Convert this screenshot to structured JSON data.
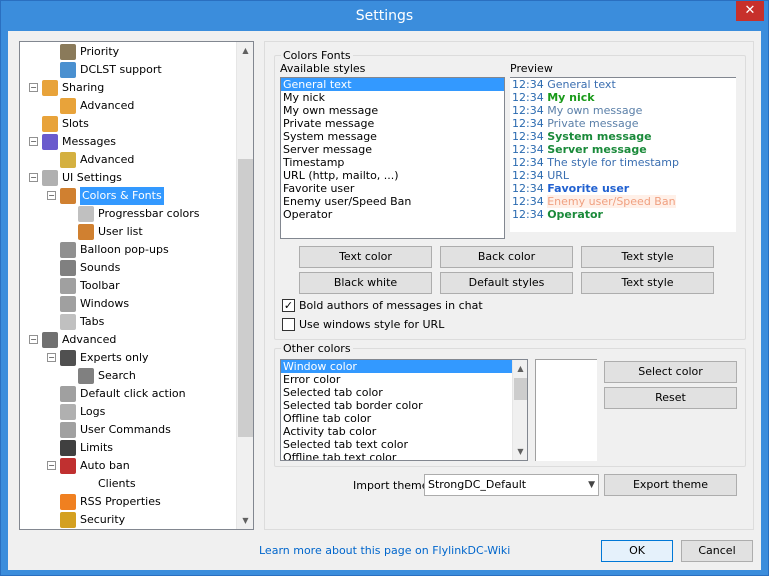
{
  "window": {
    "title": "Settings",
    "close_glyph": "✕"
  },
  "tree": {
    "items": [
      {
        "label": "Priority",
        "icon": "priority-icon",
        "color": "#8a7a5a"
      },
      {
        "label": "DCLST support",
        "icon": "dclst-icon",
        "color": "#4a90d0"
      },
      {
        "label": "Sharing",
        "icon": "sharing-icon",
        "color": "#e8a33a"
      },
      {
        "label": "Advanced",
        "icon": "advanced-sharing-icon",
        "color": "#e8a33a"
      },
      {
        "label": "Slots",
        "icon": "slots-icon",
        "color": "#e8a33a"
      },
      {
        "label": "Messages",
        "icon": "messages-icon",
        "color": "#6a5acd"
      },
      {
        "label": "Advanced",
        "icon": "advanced-messages-icon",
        "color": "#d4b040"
      },
      {
        "label": "UI Settings",
        "icon": "ui-settings-icon",
        "color": "#b0b0b0"
      },
      {
        "label": "Colors & Fonts",
        "icon": "palette-icon",
        "color": "#d08030"
      },
      {
        "label": "Progressbar colors",
        "icon": "progressbar-icon",
        "color": "#c0c0c0"
      },
      {
        "label": "User list",
        "icon": "user-list-icon",
        "color": "#d08030"
      },
      {
        "label": "Balloon pop-ups",
        "icon": "balloon-icon",
        "color": "#909090"
      },
      {
        "label": "Sounds",
        "icon": "speaker-icon",
        "color": "#808080"
      },
      {
        "label": "Toolbar",
        "icon": "toolbar-icon",
        "color": "#a0a0a0"
      },
      {
        "label": "Windows",
        "icon": "windows-icon",
        "color": "#a0a0a0"
      },
      {
        "label": "Tabs",
        "icon": "tabs-icon",
        "color": "#c0c0c0"
      },
      {
        "label": "Advanced",
        "icon": "tools-icon",
        "color": "#707070"
      },
      {
        "label": "Experts only",
        "icon": "expert-icon",
        "color": "#505050"
      },
      {
        "label": "Search",
        "icon": "search-icon",
        "color": "#808080"
      },
      {
        "label": "Default click action",
        "icon": "mouse-icon",
        "color": "#a0a0a0"
      },
      {
        "label": "Logs",
        "icon": "logs-icon",
        "color": "#b0b0b0"
      },
      {
        "label": "User Commands",
        "icon": "user-commands-icon",
        "color": "#a0a0a0"
      },
      {
        "label": "Limits",
        "icon": "limits-icon",
        "color": "#404040"
      },
      {
        "label": "Auto ban",
        "icon": "auto-ban-icon",
        "color": "#c03030"
      },
      {
        "label": "Clients",
        "icon": "",
        "color": ""
      },
      {
        "label": "RSS Properties",
        "icon": "rss-icon",
        "color": "#f08020"
      },
      {
        "label": "Security",
        "icon": "lock-icon",
        "color": "#d4a020"
      }
    ]
  },
  "colors_fonts": {
    "legend": "Colors  Fonts",
    "available_styles_label": "Available styles",
    "preview_label": "Preview",
    "styles": [
      "General text",
      "My nick",
      "My own message",
      "Private message",
      "System message",
      "Server message",
      "Timestamp",
      "URL (http, mailto, ...)",
      "Favorite user",
      "Enemy user/Speed Ban",
      "Operator"
    ],
    "preview": [
      {
        "time": "12:34",
        "text": "General text",
        "color": "#3a6eb0",
        "bold": false
      },
      {
        "time": "12:34",
        "text": "My nick",
        "color": "#1a9a1a",
        "bold": true
      },
      {
        "time": "12:34",
        "text": "My own message",
        "color": "#5a7fa8",
        "bold": false
      },
      {
        "time": "12:34",
        "text": "Private message",
        "color": "#5a7fa8",
        "bold": false
      },
      {
        "time": "12:34",
        "text": "System message",
        "color": "#1a8a3a",
        "bold": true
      },
      {
        "time": "12:34",
        "text": "Server message",
        "color": "#1a8a3a",
        "bold": true
      },
      {
        "time": "12:34",
        "text": "The style for timestamp",
        "color": "#3a6eb0",
        "bold": false
      },
      {
        "time": "12:34",
        "text": "URL",
        "color": "#3a6eb0",
        "bold": false
      },
      {
        "time": "12:34",
        "text": "Favorite user",
        "color": "#2060d0",
        "bold": true
      },
      {
        "time": "12:34",
        "text": "Enemy user/Speed Ban",
        "color": "#f0a080",
        "bold": false
      },
      {
        "time": "12:34",
        "text": "Operator",
        "color": "#1a8a3a",
        "bold": true
      }
    ],
    "time_color": "#2a6ab0",
    "buttons": {
      "text_color": "Text color",
      "back_color": "Back color",
      "text_style_1": "Text style",
      "black_white": "Black  white",
      "default_styles": "Default styles",
      "text_style_2": "Text style"
    },
    "bold_authors_label": "Bold authors of messages in chat",
    "bold_authors_checked": true,
    "windows_style_url_label": "Use windows style for URL",
    "windows_style_url_checked": false
  },
  "other_colors": {
    "legend": "Other colors",
    "items": [
      "Window color",
      "Error color",
      "Selected tab color",
      "Selected tab border color",
      "Offline tab color",
      "Activity tab color",
      "Selected tab text color",
      "Offline tab text color"
    ],
    "select_color": "Select color",
    "reset": "Reset"
  },
  "theme": {
    "import_label": "Import theme",
    "selected": "StrongDC_Default",
    "export_button": "Export theme"
  },
  "footer": {
    "link": "Learn more about this page on FlylinkDC-Wiki",
    "ok": "OK",
    "cancel": "Cancel"
  }
}
